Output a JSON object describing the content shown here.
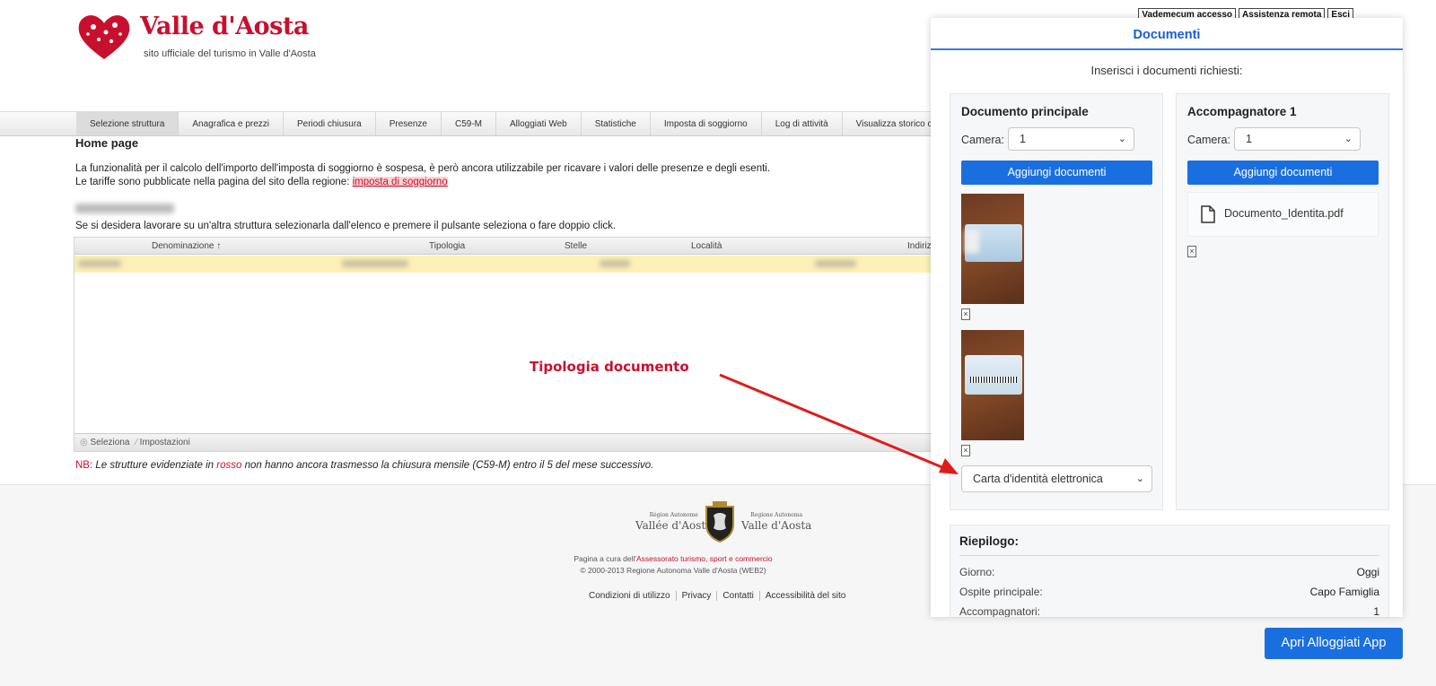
{
  "header": {
    "brand": "Valle d'Aosta",
    "subtitle": "sito ufficiale del turismo in Valle d'Aosta",
    "top_links": [
      "Vademecum accesso",
      "Assistenza remota",
      "Esci"
    ]
  },
  "nav": {
    "items": [
      "Selezione struttura",
      "Anagrafica e prezzi",
      "Periodi chiusura",
      "Presenze",
      "C59-M",
      "Alloggiati Web",
      "Statistiche",
      "Imposta di soggiorno",
      "Log di attività",
      "Visualizza storico ca"
    ]
  },
  "main": {
    "title": "Home page",
    "para1": "La funzionalità per il calcolo dell'importo dell'imposta di soggiorno è sospesa, è però ancora utilizzabile per ricavare i valori delle presenze e degli esenti.",
    "para2": "Le tariffe sono pubblicate nella pagina del sito della regione: ",
    "para2_link": "imposta di soggiorno",
    "instruction": "Se si desidera lavorare su un'altra struttura selezionarla dall'elenco e premere il pulsante seleziona o fare doppio click.",
    "table": {
      "columns": [
        "Denominazione ↑",
        "Tipologia",
        "Stelle",
        "Località",
        "Indiriz"
      ]
    },
    "footer_actions": [
      "Seleziona",
      "Impostazioni"
    ],
    "nb": {
      "label": "NB:",
      "text_before": " Le strutture evidenziate in ",
      "red_word": "rosso",
      "text_after": " non hanno ancora trasmesso la chiusura mensile (C59-M) entro il 5 del mese successivo."
    }
  },
  "footer": {
    "region_left_small": "Région Autonome",
    "region_left_big": "Vallée d'Aoste",
    "region_right_small": "Regione Autonoma",
    "region_right_big": "Valle d'Aosta",
    "line1_prefix": "Pagina a cura dell'",
    "line1_link": "Assessorato turismo, sport e commercio",
    "line2": "© 2000-2013 Regione Autonoma Valle d'Aosta (WEB2)",
    "links": [
      "Condizioni di utilizzo",
      "Privacy",
      "Contatti",
      "Accessibilità del sito"
    ]
  },
  "annotation": {
    "label": "Tipologia documento"
  },
  "panel": {
    "title": "Documenti",
    "instruction": "Inserisci i documenti richiesti:",
    "left": {
      "title": "Documento principale",
      "camera_label": "Camera:",
      "camera_value": "1",
      "add_button": "Aggiungi documenti",
      "doc_type": "Carta d'identità elettronica"
    },
    "right": {
      "title": "Accompagnatore 1",
      "camera_label": "Camera:",
      "camera_value": "1",
      "add_button": "Aggiungi documenti",
      "file_name": "Documento_Identita.pdf"
    },
    "remove_glyph": "×",
    "summary": {
      "title": "Riepilogo:",
      "rows": [
        {
          "label": "Giorno:",
          "value": "Oggi"
        },
        {
          "label": "Ospite principale:",
          "value": "Capo Famiglia"
        },
        {
          "label": "Accompagnatori:",
          "value": "1"
        }
      ]
    },
    "open_app": "Apri Alloggiati App"
  },
  "colors": {
    "brand_red": "#c8102e",
    "panel_blue": "#1a6fe0",
    "row_highlight": "#fdf1b8"
  }
}
